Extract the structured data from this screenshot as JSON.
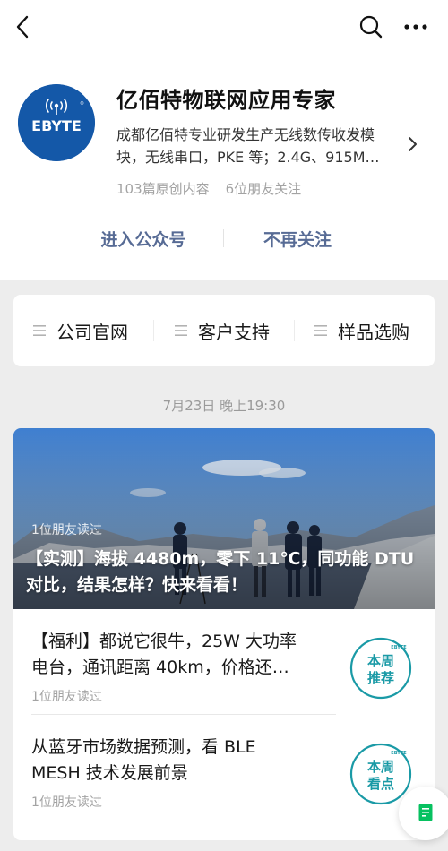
{
  "account": {
    "name": "亿佰特物联网应用专家",
    "logo_text": "EBYTE",
    "description_lines": [
      "成都亿佰特专业研发生产无线数传收发模",
      "块，无线串口，PKE 等；2.4G、915M…"
    ],
    "articles_count": "103篇原创内容",
    "friends_following": "6位朋友关注"
  },
  "actions": {
    "enter": "进入公众号",
    "unfollow": "不再关注"
  },
  "menu": [
    {
      "label": "公司官网"
    },
    {
      "label": "客户支持"
    },
    {
      "label": "样品选购"
    }
  ],
  "feed": {
    "date": "7月23日 晚上19:30",
    "hero": {
      "reads": "1位朋友读过",
      "title_lines": [
        "【实测】海拔 4480m，零下 11℃，同功能 DTU",
        "对比，结果怎样？快来看看！"
      ]
    },
    "items": [
      {
        "title_lines": [
          "【福利】都说它很牛，25W 大功率",
          "电台，通讯距离 40km，价格还…"
        ],
        "reads": "1位朋友读过",
        "badge_lines": [
          "本周",
          "推荐"
        ]
      },
      {
        "title_lines": [
          "从蓝牙市场数据预测，看 BLE",
          "MESH 技术发展前景"
        ],
        "reads": "1位朋友读过",
        "badge_lines": [
          "本周",
          "看点"
        ]
      }
    ]
  },
  "icons": {
    "back": "chevron-left-icon",
    "search": "search-icon",
    "more": "more-dots-icon",
    "profile_arrow": "chevron-right-icon",
    "menu": "menu-lines-icon",
    "float": "document-icon"
  },
  "colors": {
    "link_blue": "#576b95",
    "badge_teal": "#1a9aa6",
    "logo_blue": "#1458a8",
    "float_green": "#07c160"
  }
}
